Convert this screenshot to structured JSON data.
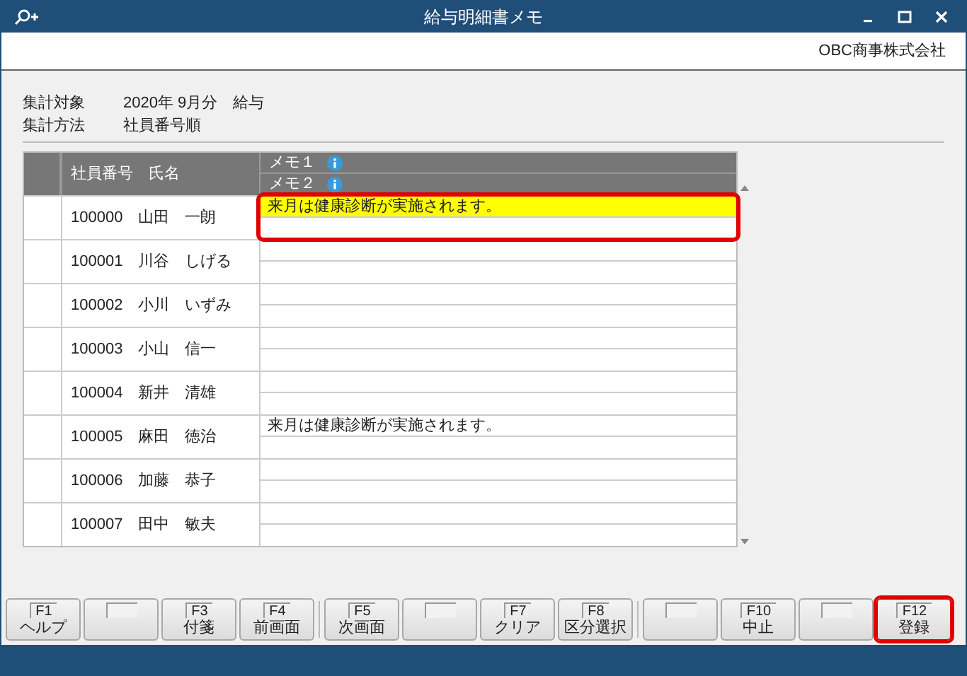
{
  "window": {
    "title": "給与明細書メモ"
  },
  "company": "OBC商事株式会社",
  "summary": [
    {
      "label": "集計対象",
      "value": "2020年 9月分　給与"
    },
    {
      "label": "集計方法",
      "value": "社員番号順"
    }
  ],
  "table": {
    "columns": {
      "employee": "社員番号　氏名",
      "memo1": "メモ１",
      "memo2": "メモ２"
    },
    "rows": [
      {
        "employee": "100000　山田　一朗",
        "memo1": "来月は健康診断が実施されます。",
        "memo1_active": true,
        "highlighted": true
      },
      {
        "employee": "100001　川谷　しげる",
        "memo1_active": false,
        "highlighted": false
      },
      {
        "employee": "100002　小川　いずみ",
        "memo1_active": false,
        "highlighted": false
      },
      {
        "employee": "100003　小山　信一",
        "memo1_active": false,
        "highlighted": false
      },
      {
        "employee": "100004　新井　清雄",
        "memo1_active": false,
        "highlighted": false
      },
      {
        "employee": "100005　麻田　徳治",
        "memo1": "来月は健康診断が実施されます。",
        "memo1_active": false,
        "highlighted": false
      },
      {
        "employee": "100006　加藤　恭子",
        "memo1_active": false,
        "highlighted": false
      },
      {
        "employee": "100007　田中　敏夫",
        "memo1_active": false,
        "highlighted": false
      }
    ]
  },
  "function_keys": [
    {
      "key": "F1",
      "label": "ヘルプ",
      "highlighted": false
    },
    {
      "highlighted": false
    },
    {
      "key": "F3",
      "label": "付箋",
      "highlighted": false
    },
    {
      "key": "F4",
      "label": "前画面",
      "highlighted": false
    },
    {
      "key": "F5",
      "label": "次画面",
      "highlighted": false
    },
    {
      "highlighted": false
    },
    {
      "key": "F7",
      "label": "クリア",
      "highlighted": false
    },
    {
      "key": "F8",
      "label": "区分選択",
      "highlighted": false
    },
    {
      "highlighted": false
    },
    {
      "key": "F10",
      "label": "中止",
      "highlighted": false
    },
    {
      "highlighted": false
    },
    {
      "key": "F12",
      "label": "登録",
      "highlighted": true
    }
  ]
}
